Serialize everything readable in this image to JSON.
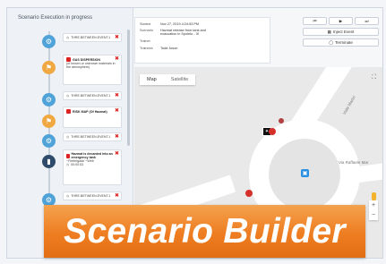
{
  "left_panel": {
    "title": "Scenario Execution in progress",
    "cards": [
      {
        "text": "THRE.BETWEEN.EVENT.1"
      },
      {
        "title": "GAS DISPERSION",
        "body": "(of known or unknown materials in the atmosphere)"
      },
      {
        "text": "THRE.BETWEEN.EVENT.1"
      },
      {
        "title": "RISK MAP (Of Hazmat)"
      },
      {
        "text": "THRE.BETWEEN.EVENT.1"
      },
      {
        "title": "Hazmat is decanted into an emergency tank",
        "body": "~Firebrigade ~Web",
        "time": "00:00:53"
      },
      {
        "text": "THRE.BETWEEN.EVENT.1"
      }
    ]
  },
  "info": {
    "started_label": "Started",
    "started_value": "Nov 27, 2019 4:24:53 PM",
    "scenario_label": "Scenario",
    "scenario_value": "Hazmat release from tank and evacuation in Spoleto - III",
    "trainer_label": "Trainer",
    "trainees_label": "Trainees",
    "trainees_value": "Todd Joson"
  },
  "controls": {
    "btn_prev": "⏮",
    "btn_play": "▶",
    "btn_next": "⏭",
    "inject_icon": "▦",
    "inject_label": "Inject Event",
    "terminate_icon": "◯",
    "terminate_label": "Terminate"
  },
  "map": {
    "tab_map": "Map",
    "tab_satellite": "Satellite",
    "fullscreen_icon": "⛶",
    "road_label_1": "Viale Martiri",
    "road_label_2": "Via Raffaele Mar",
    "zoom_in": "+",
    "zoom_out": "−"
  },
  "banner": {
    "text": "Scenario Builder"
  }
}
